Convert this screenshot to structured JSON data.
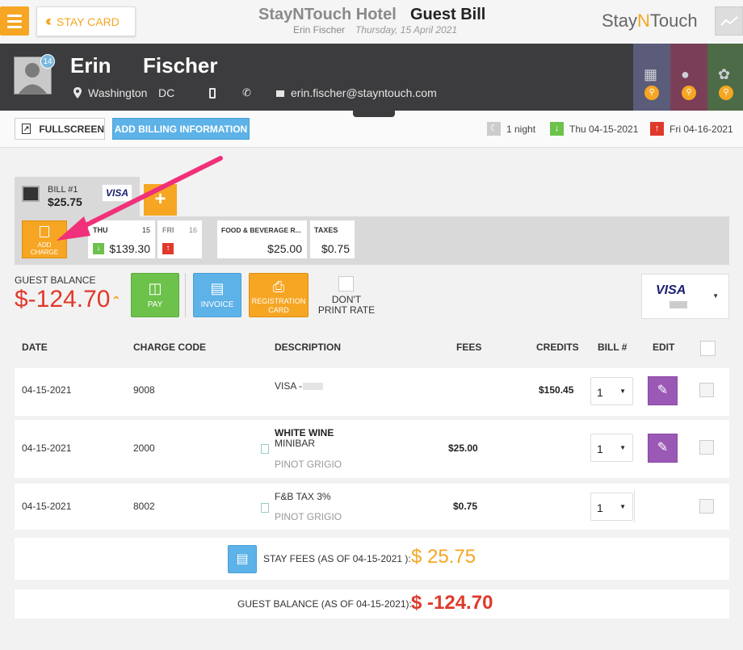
{
  "topbar": {
    "stay_card_label": "STAY CARD",
    "hotel_name": "StayNTouch Hotel",
    "page_title": "Guest Bill",
    "guest_name": "Erin Fischer",
    "date": "Thursday, 15 April 2021",
    "logo_left": "Stay",
    "logo_mid": "N",
    "logo_right": "Touch"
  },
  "guest": {
    "first_name": "Erin",
    "last_name": "Fischer",
    "badge": "14",
    "city": "Washington",
    "state": "DC",
    "email": "erin.fischer@stayntouch.com"
  },
  "toolbar": {
    "fullscreen_label": "FULLSCREEN",
    "billing_info_label": "ADD BILLING INFORMATION",
    "nights": "1 night",
    "arrival": "Thu 04-15-2021",
    "departure": "Fri 04-16-2021"
  },
  "bill": {
    "label": "BILL #1",
    "amount": "$25.75",
    "card_brand": "VISA",
    "add_label": "+",
    "add_charge_label_1": "ADD",
    "add_charge_label_2": "CHARGE",
    "days": [
      {
        "day": "THU",
        "num": "15",
        "amount": "$139.30"
      },
      {
        "day": "FRI",
        "num": "16",
        "amount": ""
      }
    ],
    "categories": [
      {
        "name": "FOOD & BEVERAGE R...",
        "amount": "$25.00"
      },
      {
        "name": "TAXES",
        "amount": "$0.75"
      }
    ]
  },
  "balance": {
    "label": "GUEST BALANCE",
    "amount": "$-124.70",
    "pay_label": "PAY",
    "invoice_label": "INVOICE",
    "regcard_label_1": "REGISTRATION",
    "regcard_label_2": "CARD",
    "dont_print_label": "DON'T PRINT RATE",
    "payment_brand": "VISA"
  },
  "table": {
    "headers": {
      "date": "DATE",
      "code": "CHARGE CODE",
      "description": "DESCRIPTION",
      "fees": "FEES",
      "credits": "CREDITS",
      "bill": "BILL #",
      "edit": "EDIT"
    },
    "rows": [
      {
        "date": "04-15-2021",
        "code": "9008",
        "desc": "VISA -",
        "desc2": "",
        "sub": "",
        "fees": "",
        "credits": "$150.45",
        "bill": "1"
      },
      {
        "date": "04-15-2021",
        "code": "2000",
        "desc": "WHITE WINE",
        "desc2": "MINIBAR",
        "sub": "PINOT GRIGIO",
        "fees": "$25.00",
        "credits": "",
        "bill": "1"
      },
      {
        "date": "04-15-2021",
        "code": "8002",
        "desc": "F&B TAX 3%",
        "desc2": "",
        "sub": "PINOT GRIGIO",
        "fees": "$0.75",
        "credits": "",
        "bill": "1"
      }
    ]
  },
  "summary": {
    "stay_fees_label": "STAY FEES (AS OF 04-15-2021 ):",
    "stay_fees_amount": "$ 25.75",
    "guest_balance_label": "GUEST BALANCE (AS OF 04-15-2021):",
    "guest_balance_amount": "$ -124.70"
  },
  "colors": {
    "accent": "#f6a623",
    "info": "#5db2e8",
    "success": "#6cc24a",
    "danger": "#e0392b",
    "edit": "#9b59b6",
    "pointer": "#f0307a"
  }
}
